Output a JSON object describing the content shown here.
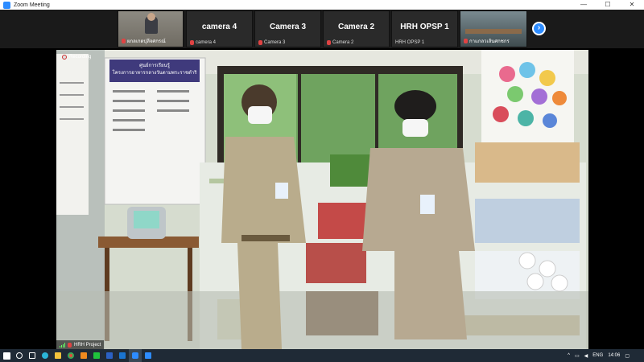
{
  "window": {
    "title": "Zoom Meeting",
    "minimize": "—",
    "maximize": "☐",
    "close": "✕"
  },
  "gallery": {
    "tiles": [
      {
        "name_small": "ผกลเกดปุลีจศกรณ์"
      },
      {
        "name_big": "camera 4",
        "name_small": "camera 4"
      },
      {
        "name_big": "Camera 3",
        "name_small": "Camera 3"
      },
      {
        "name_big": "Camera 2",
        "name_small": "Camera 2"
      },
      {
        "name_big": "HRH OPSP 1",
        "name_small": "HRH OPSP 1"
      },
      {
        "name_small": "กาแกลวเส้นศกชกร"
      }
    ],
    "next_icon": "›"
  },
  "stage": {
    "recording_label": "Recording",
    "speaker_name": "HRH Project",
    "poster_title": "ศูนย์การเรียนรู้",
    "poster_sub": "โครงการอาหารกลางวันตามพระราชดำริ"
  },
  "taskbar": {
    "apps": [
      "windows-icon",
      "search-icon",
      "task-view-icon",
      "edge-icon",
      "explorer-icon",
      "chrome-icon",
      "vlc-icon",
      "line-icon",
      "word-icon",
      "outlook-icon",
      "zoom-icon",
      "app-icon"
    ],
    "language": "ENG",
    "time": "14:06"
  },
  "colors": {
    "accent": "#2d8cff",
    "taskbar": "#1f2a36",
    "mic_muted": "#e04343"
  }
}
